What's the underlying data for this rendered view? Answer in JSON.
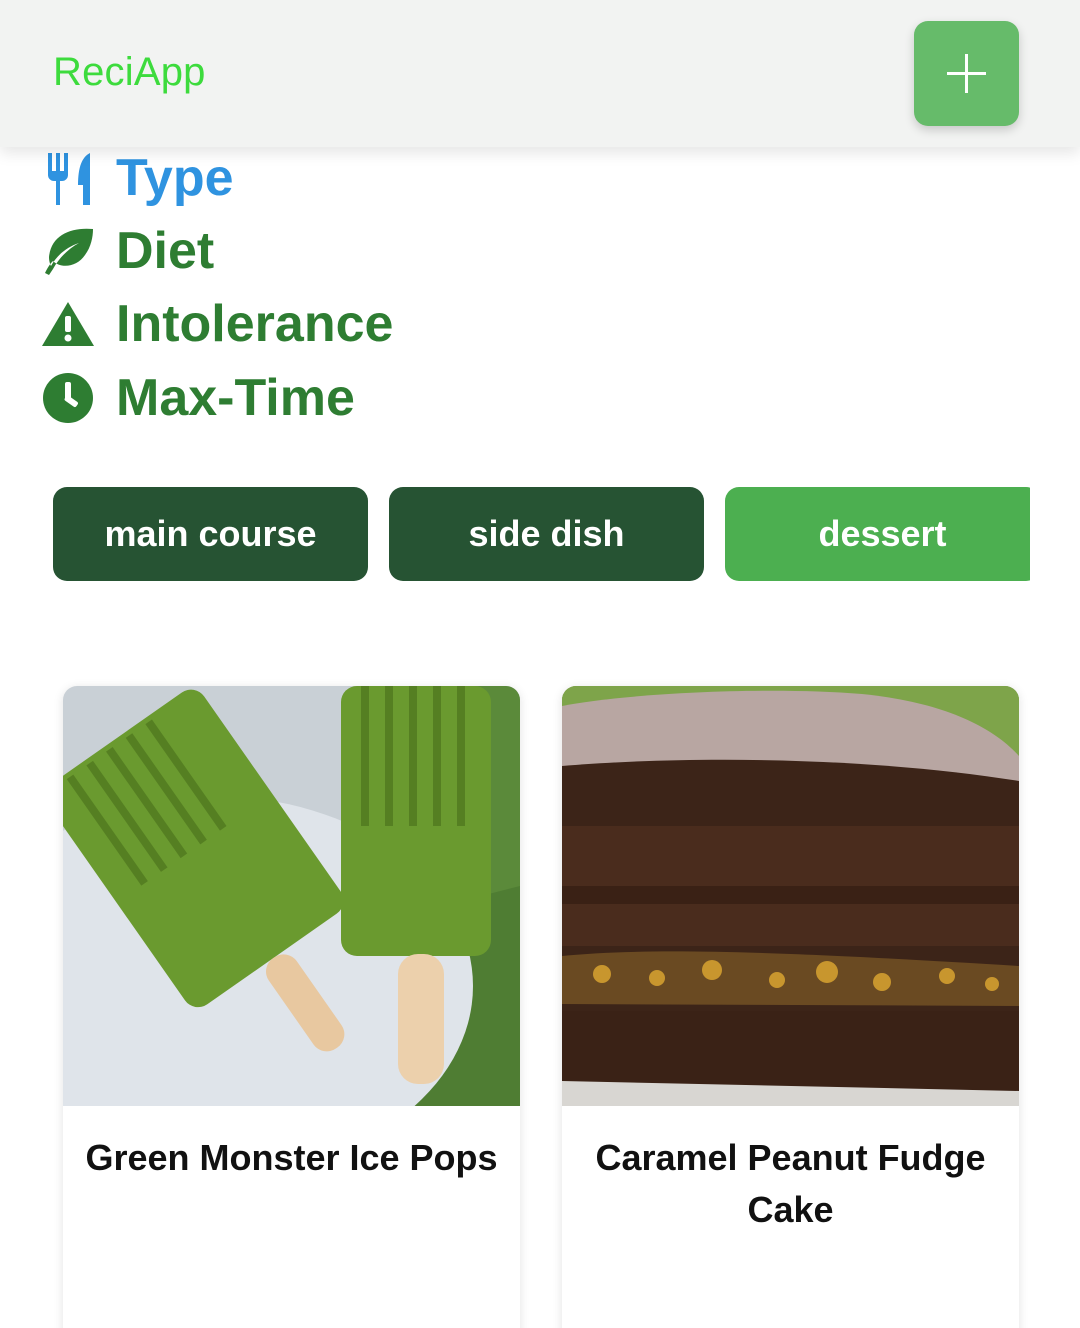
{
  "app": {
    "title": "ReciApp",
    "add_button_icon": "plus-icon"
  },
  "filters": [
    {
      "label": "Type",
      "icon": "utensils-icon",
      "active": true
    },
    {
      "label": "Diet",
      "icon": "leaf-icon",
      "active": false
    },
    {
      "label": "Intolerance",
      "icon": "warning-icon",
      "active": false
    },
    {
      "label": "Max-Time",
      "icon": "clock-icon",
      "active": false
    }
  ],
  "chips": [
    {
      "label": "main course",
      "selected": false
    },
    {
      "label": "side dish",
      "selected": false
    },
    {
      "label": "dessert",
      "selected": true
    }
  ],
  "recipes": [
    {
      "title": "Green Monster Ice Pops",
      "image": "green-ice-pops-photo"
    },
    {
      "title": "Caramel Peanut Fudge Cake",
      "image": "fudge-cake-photo"
    }
  ],
  "colors": {
    "brand": "#3ddb3d",
    "accent_green": "#66bb6a",
    "filter_active": "#2f93e0",
    "filter_text": "#2e7d32",
    "chip_dark": "#265333",
    "chip_selected": "#4caf50"
  }
}
